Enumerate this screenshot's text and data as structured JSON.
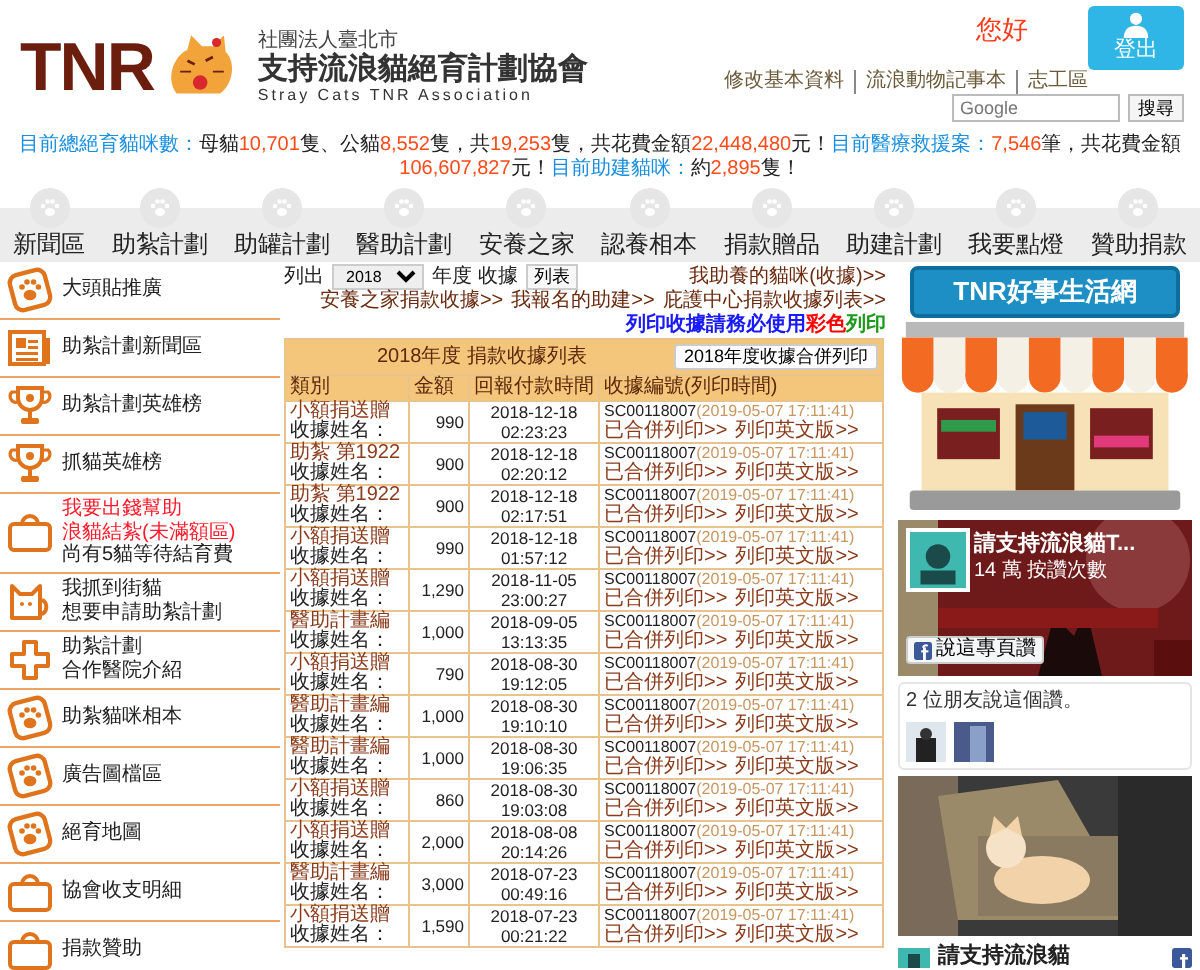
{
  "header": {
    "logo_text": "TNR",
    "org_prefix": "社團法人臺北市",
    "org_name": "支持流浪貓絕育計劃協會",
    "org_english": "Stray Cats TNR Association",
    "greeting": "您好",
    "logout": "登出",
    "links": [
      "修改基本資料",
      "流浪動物記事本",
      "志工區"
    ],
    "search": {
      "placeholder": "Google",
      "button": "搜尋"
    }
  },
  "stats": [
    {
      "kind": "label",
      "text": "目前總絕育貓咪數："
    },
    {
      "kind": "text",
      "text": "母貓"
    },
    {
      "kind": "number",
      "text": "10,701"
    },
    {
      "kind": "text",
      "text": "隻、公貓"
    },
    {
      "kind": "number",
      "text": "8,552"
    },
    {
      "kind": "text",
      "text": "隻，共"
    },
    {
      "kind": "number",
      "text": "19,253"
    },
    {
      "kind": "text",
      "text": "隻，共花費金額"
    },
    {
      "kind": "number",
      "text": "22,448,480"
    },
    {
      "kind": "text",
      "text": "元！"
    },
    {
      "kind": "label",
      "text": "目前醫療救援案："
    },
    {
      "kind": "number",
      "text": "7,546"
    },
    {
      "kind": "text",
      "text": "筆，共花費金額"
    },
    {
      "kind": "number",
      "text": "106,607,827"
    },
    {
      "kind": "text",
      "text": "元！"
    },
    {
      "kind": "label",
      "text": "目前助建貓咪："
    },
    {
      "kind": "text",
      "text": "約"
    },
    {
      "kind": "number",
      "text": "2,895"
    },
    {
      "kind": "text",
      "text": "隻！"
    }
  ],
  "nav": [
    "新聞區",
    "助紮計劃",
    "助罐計劃",
    "醫助計劃",
    "安養之家",
    "認養相本",
    "捐款贈品",
    "助建計劃",
    "我要點燈",
    "贊助捐款"
  ],
  "sidebar": [
    {
      "kind": "paw",
      "lines": [
        {
          "text": "大頭貼推廣",
          "alert": false
        }
      ]
    },
    {
      "kind": "news",
      "lines": [
        {
          "text": "助紮計劃新聞區",
          "alert": false
        }
      ]
    },
    {
      "kind": "trophy",
      "lines": [
        {
          "text": "助紮計劃英雄榜",
          "alert": false
        }
      ]
    },
    {
      "kind": "trophy",
      "lines": [
        {
          "text": "抓貓英雄榜",
          "alert": false
        }
      ]
    },
    {
      "kind": "box",
      "lines": [
        {
          "text": "我要出錢幫助",
          "alert": true
        },
        {
          "text": "浪貓結紮(未滿額區)",
          "alert": true
        },
        {
          "text": "尚有5貓等待結育費",
          "alert": false
        }
      ]
    },
    {
      "kind": "cat",
      "lines": [
        {
          "text": "我抓到街貓",
          "alert": false
        },
        {
          "text": "想要申請助紮計劃",
          "alert": false
        }
      ]
    },
    {
      "kind": "cross",
      "lines": [
        {
          "text": "助紮計劃",
          "alert": false
        },
        {
          "text": "合作醫院介紹",
          "alert": false
        }
      ]
    },
    {
      "kind": "paw",
      "lines": [
        {
          "text": "助紮貓咪相本",
          "alert": false
        }
      ]
    },
    {
      "kind": "paw",
      "lines": [
        {
          "text": "廣告圖檔區",
          "alert": false
        }
      ]
    },
    {
      "kind": "paw",
      "lines": [
        {
          "text": "絕育地圖",
          "alert": false
        }
      ]
    },
    {
      "kind": "box",
      "lines": [
        {
          "text": "協會收支明細",
          "alert": false
        }
      ]
    },
    {
      "kind": "box",
      "lines": [
        {
          "text": "捐款贊助",
          "alert": false
        }
      ]
    }
  ],
  "filter": {
    "label": "列出",
    "year": "2018",
    "suffix": "年度 收據",
    "button": "列表"
  },
  "links": [
    "我助養的貓咪(收據)>>",
    "安養之家捐款收據>>",
    "我報名的助建>>",
    "庇護中心捐款收據列表>>"
  ],
  "notice": [
    {
      "text": "列印收據請務必使用",
      "color": "#1a1aff"
    },
    {
      "text": "彩色",
      "color": "#ff0000"
    },
    {
      "text": "列印",
      "color": "#1a9a1a"
    }
  ],
  "table": {
    "title": "2018年度 捐款收據列表",
    "merge_button": "2018年度收據合併列印",
    "columns": [
      "類別",
      "金額",
      "回報付款時間",
      "收據編號(列印時間)"
    ],
    "rows": [
      {
        "category": "小額捐送贈",
        "name_label": "收據姓名：",
        "amount": "990",
        "date": "2018-12-18",
        "time": "02:23:23",
        "receipt_no": "SC00118007",
        "printed_at": "(2019-05-07 17:11:41)",
        "merged": "已合併列印>>",
        "english": "列印英文版>>"
      },
      {
        "category": "助紮 第1922",
        "name_label": "收據姓名：",
        "amount": "900",
        "date": "2018-12-18",
        "time": "02:20:12",
        "receipt_no": "SC00118007",
        "printed_at": "(2019-05-07 17:11:41)",
        "merged": "已合併列印>>",
        "english": "列印英文版>>"
      },
      {
        "category": "助紮 第1922",
        "name_label": "收據姓名：",
        "amount": "900",
        "date": "2018-12-18",
        "time": "02:17:51",
        "receipt_no": "SC00118007",
        "printed_at": "(2019-05-07 17:11:41)",
        "merged": "已合併列印>>",
        "english": "列印英文版>>"
      },
      {
        "category": "小額捐送贈",
        "name_label": "收據姓名：",
        "amount": "990",
        "date": "2018-12-18",
        "time": "01:57:12",
        "receipt_no": "SC00118007",
        "printed_at": "(2019-05-07 17:11:41)",
        "merged": "已合併列印>>",
        "english": "列印英文版>>"
      },
      {
        "category": "小額捐送贈",
        "name_label": "收據姓名：",
        "amount": "1,290",
        "date": "2018-11-05",
        "time": "23:00:27",
        "receipt_no": "SC00118007",
        "printed_at": "(2019-05-07 17:11:41)",
        "merged": "已合併列印>>",
        "english": "列印英文版>>"
      },
      {
        "category": "醫助計畫編",
        "name_label": "收據姓名：",
        "amount": "1,000",
        "date": "2018-09-05",
        "time": "13:13:35",
        "receipt_no": "SC00118007",
        "printed_at": "(2019-05-07 17:11:41)",
        "merged": "已合併列印>>",
        "english": "列印英文版>>"
      },
      {
        "category": "小額捐送贈",
        "name_label": "收據姓名：",
        "amount": "790",
        "date": "2018-08-30",
        "time": "19:12:05",
        "receipt_no": "SC00118007",
        "printed_at": "(2019-05-07 17:11:41)",
        "merged": "已合併列印>>",
        "english": "列印英文版>>"
      },
      {
        "category": "醫助計畫編",
        "name_label": "收據姓名：",
        "amount": "1,000",
        "date": "2018-08-30",
        "time": "19:10:10",
        "receipt_no": "SC00118007",
        "printed_at": "(2019-05-07 17:11:41)",
        "merged": "已合併列印>>",
        "english": "列印英文版>>"
      },
      {
        "category": "醫助計畫編",
        "name_label": "收據姓名：",
        "amount": "1,000",
        "date": "2018-08-30",
        "time": "19:06:35",
        "receipt_no": "SC00118007",
        "printed_at": "(2019-05-07 17:11:41)",
        "merged": "已合併列印>>",
        "english": "列印英文版>>"
      },
      {
        "category": "小額捐送贈",
        "name_label": "收據姓名：",
        "amount": "860",
        "date": "2018-08-30",
        "time": "19:03:08",
        "receipt_no": "SC00118007",
        "printed_at": "(2019-05-07 17:11:41)",
        "merged": "已合併列印>>",
        "english": "列印英文版>>"
      },
      {
        "category": "小額捐送贈",
        "name_label": "收據姓名：",
        "amount": "2,000",
        "date": "2018-08-08",
        "time": "20:14:26",
        "receipt_no": "SC00118007",
        "printed_at": "(2019-05-07 17:11:41)",
        "merged": "已合併列印>>",
        "english": "列印英文版>>"
      },
      {
        "category": "醫助計畫編",
        "name_label": "收據姓名：",
        "amount": "3,000",
        "date": "2018-07-23",
        "time": "00:49:16",
        "receipt_no": "SC00118007",
        "printed_at": "(2019-05-07 17:11:41)",
        "merged": "已合併列印>>",
        "english": "列印英文版>>"
      },
      {
        "category": "小額捐送贈",
        "name_label": "收據姓名：",
        "amount": "1,590",
        "date": "2018-07-23",
        "time": "00:21:22",
        "receipt_no": "SC00118007",
        "printed_at": "(2019-05-07 17:11:41)",
        "merged": "已合併列印>>",
        "english": "列印英文版>>"
      }
    ]
  },
  "shop": {
    "sign": "TNR好事生活網"
  },
  "facebook": {
    "page_name": "請支持流浪貓T...",
    "likes": "14 萬 按讚次數",
    "like_button": "說這專頁讚",
    "friends": "2 位朋友說這個讚。",
    "post_title": "請支持流浪貓"
  }
}
